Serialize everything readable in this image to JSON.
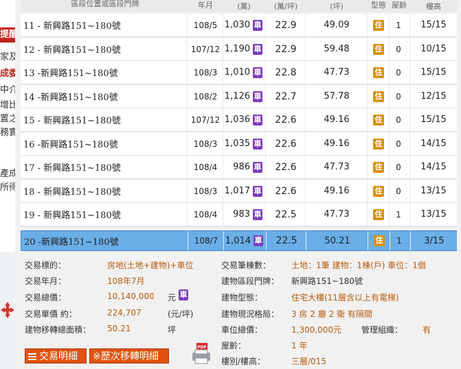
{
  "left_strip": {
    "lines": [
      "提醒",
      "家及",
      "成委",
      "中介",
      "增比",
      "置之",
      "務實",
      "產成",
      "所得"
    ]
  },
  "table": {
    "headers": {
      "address": "區段位置或區段門牌",
      "date": "年月",
      "total": "(萬)",
      "unit": "(萬/坪)",
      "area": "(坪)",
      "type": "型態",
      "age": "屋齡",
      "floor": "樓高"
    },
    "rows": [
      {
        "address": "11 - 新興路151~180號",
        "date": "108/5",
        "total": "1,030",
        "car": "車",
        "unit": "22.9",
        "area": "49.09",
        "type": "住",
        "age": "1",
        "floor": "15/15"
      },
      {
        "address": "12 - 新興路151~180號",
        "date": "107/12",
        "total": "1,190",
        "car": "車",
        "unit": "22.9",
        "area": "59.48",
        "type": "住",
        "age": "0",
        "floor": "10/15"
      },
      {
        "address": "13 -新興路151~180號",
        "date": "108/3",
        "total": "1,010",
        "car": "車",
        "unit": "22.8",
        "area": "47.73",
        "type": "住",
        "age": "0",
        "floor": "15/15"
      },
      {
        "address": "14 -新興路151~180號",
        "date": "108/2",
        "total": "1,126",
        "car": "車",
        "unit": "22.7",
        "area": "57.78",
        "type": "住",
        "age": "0",
        "floor": "12/15"
      },
      {
        "address": "15 - 新興路151~180號",
        "date": "107/12",
        "total": "1,036",
        "car": "車",
        "unit": "22.6",
        "area": "49.16",
        "type": "住",
        "age": "0",
        "floor": "15/15"
      },
      {
        "address": "16 -新興路151~180號",
        "date": "108/3",
        "total": "1,035",
        "car": "車",
        "unit": "22.6",
        "area": "49.16",
        "type": "住",
        "age": "0",
        "floor": "14/15"
      },
      {
        "address": "17 - 新興路151~180號",
        "date": "108/4",
        "total": "986",
        "car": "車",
        "unit": "22.6",
        "area": "47.73",
        "type": "住",
        "age": "0",
        "floor": "14/15"
      },
      {
        "address": "18 - 新興路151~180號",
        "date": "108/3",
        "total": "1,017",
        "car": "車",
        "unit": "22.6",
        "area": "49.16",
        "type": "住",
        "age": "0",
        "floor": "13/15"
      },
      {
        "address": "19 - 新興路151~180號",
        "date": "108/4",
        "total": "983",
        "car": "車",
        "unit": "22.5",
        "area": "47.73",
        "type": "住",
        "age": "1",
        "floor": "13/15"
      },
      {
        "address": "20 -新興路151~180號",
        "date": "108/7",
        "total": "1,014",
        "car": "車",
        "unit": "22.5",
        "area": "50.21",
        "type": "住",
        "age": "1",
        "floor": "3/15",
        "selected": true
      }
    ]
  },
  "details": {
    "target_label": "交易標的：",
    "target_value": "房地(土地+建物)+車位",
    "ym_label": "交易年月：",
    "ym_value": "108年7月",
    "total_label": "交易總價：",
    "total_value": "10,140,000",
    "total_unit": "元",
    "car_badge": "車",
    "unitprice_label": "交易單價 約：",
    "unitprice_value": "224,707",
    "unitprice_unit": "(元/坪)",
    "area_label": "建物移轉總面積：",
    "area_value": "50.21",
    "area_unit": "坪",
    "count_label": "交易筆棟數：",
    "count_value": "土地：1筆 建物：1棟(戶) 車位：1個",
    "addr_label": "建物區段門牌：",
    "addr_value": "新興路151~180號",
    "btype_label": "建物型態：",
    "btype_value": "住宅大樓(11層含以上有電梯)",
    "layout_label": "建物現況格局：",
    "layout_value": "3 房 2 廳 2 衛 有隔間",
    "parking_label": "車位總價：",
    "parking_value": "1,300,000元",
    "mgmt_label": "管理組織：",
    "mgmt_value": "有",
    "age_label": "屋齡：",
    "age_value": "1 年",
    "floor_label": "樓別/樓高：",
    "floor_value": "三層/015"
  },
  "buttons": {
    "detail": "交易明細",
    "history": "※歷次移轉明細",
    "pdf": "PDF"
  },
  "colors": {
    "selected_row": "#6aaee8",
    "car_badge": "#7c3dbb",
    "type_badge": "#d8900f",
    "detail_value": "#b85b0c",
    "button": "#e0520f"
  }
}
